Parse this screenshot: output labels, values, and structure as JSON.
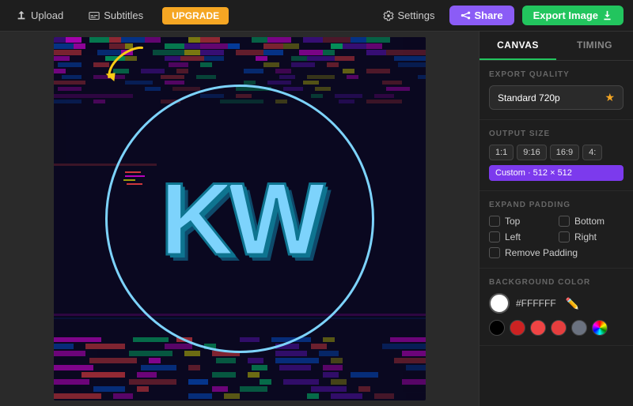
{
  "topbar": {
    "upload_label": "Upload",
    "subtitles_label": "Subtitles",
    "upgrade_label": "UPGRADE",
    "settings_label": "Settings",
    "share_label": "Share",
    "export_label": "Export Image"
  },
  "panel": {
    "canvas_tab": "CANVAS",
    "timing_tab": "TIMING",
    "export_quality_label": "EXPORT QUALITY",
    "quality_value": "Standard 720p",
    "output_size_label": "OUTPUT SIZE",
    "size_options": [
      "1:1",
      "9:16",
      "16:9",
      "4:"
    ],
    "custom_label": "Custom · 512 × 512",
    "expand_padding_label": "EXPAND PADDING",
    "expand_top": "Top",
    "expand_bottom": "Bottom",
    "expand_left": "Left",
    "expand_right": "Right",
    "remove_padding_label": "Remove Padding",
    "bg_color_label": "BACKGROUND COLOR",
    "bg_hex": "#FFFFFF",
    "bg_color": "#ffffff",
    "presets": [
      "#000000",
      "#ef4444",
      "#facc15",
      "#ef4444",
      "#6b7280",
      "#1d4ed8"
    ]
  }
}
